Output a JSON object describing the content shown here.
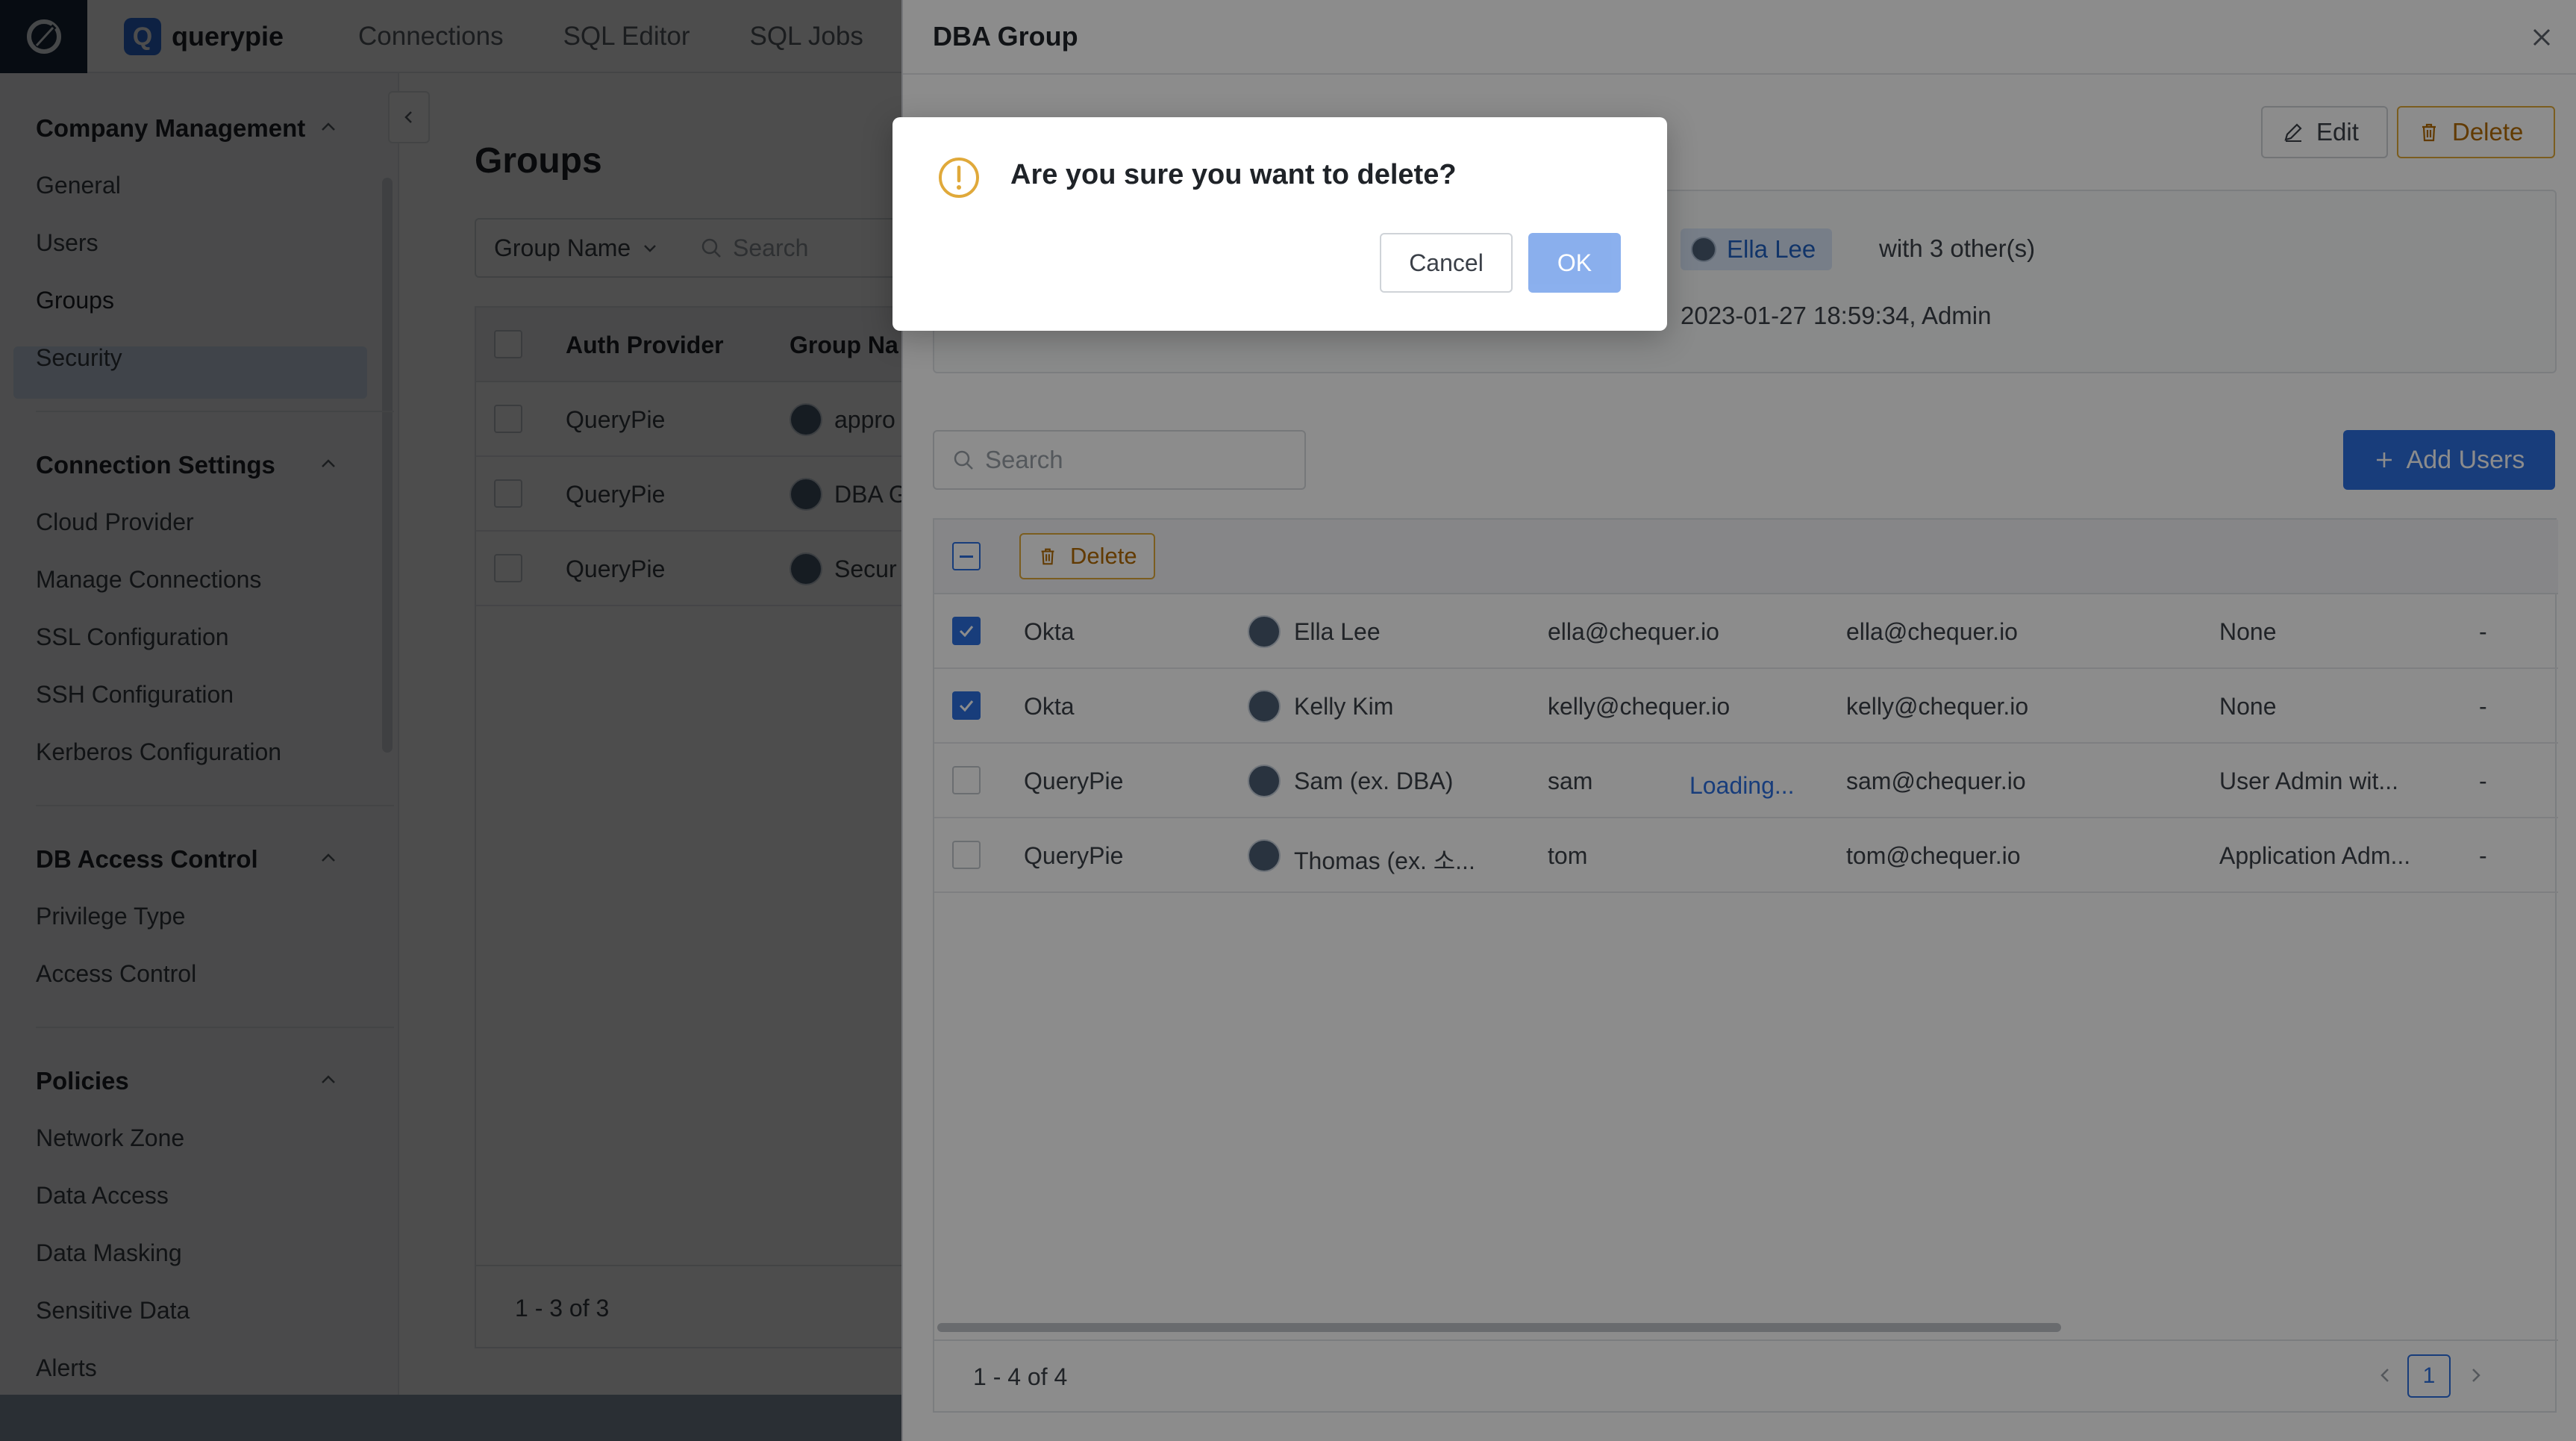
{
  "app": {
    "brand": "querypie",
    "brand_mark": "Q",
    "nav": [
      "Connections",
      "SQL Editor",
      "SQL Jobs"
    ]
  },
  "sidebar": {
    "sections": [
      {
        "title": "Company Management",
        "items": [
          "General",
          "Users",
          "Groups",
          "Security"
        ]
      },
      {
        "title": "Connection Settings",
        "items": [
          "Cloud Provider",
          "Manage Connections",
          "SSL Configuration",
          "SSH Configuration",
          "Kerberos Configuration"
        ]
      },
      {
        "title": "DB Access Control",
        "items": [
          "Privilege Type",
          "Access Control"
        ]
      },
      {
        "title": "Policies",
        "items": [
          "Network Zone",
          "Data Access",
          "Data Masking",
          "Sensitive Data",
          "Alerts"
        ]
      }
    ],
    "active_item": "Groups"
  },
  "groups_page": {
    "title": "Groups",
    "filter_field": "Group Name",
    "search_placeholder": "Search",
    "columns": [
      "Auth Provider",
      "Group Na"
    ],
    "rows": [
      {
        "provider": "QueryPie",
        "name": "appro"
      },
      {
        "provider": "QueryPie",
        "name": "DBA G"
      },
      {
        "provider": "QueryPie",
        "name": "Secur"
      }
    ],
    "footer": "1 - 3 of 3"
  },
  "drawer": {
    "title": "DBA Group",
    "edit_label": "Edit",
    "delete_label": "Delete",
    "owner_name": "Ella Lee",
    "owner_extra": "with 3 other(s)",
    "updated": "2023-01-27 18:59:34, Admin",
    "search_placeholder": "Search",
    "add_users_label": "Add Users",
    "bulk_delete_label": "Delete",
    "loading_text": "Loading...",
    "members": [
      {
        "checked": true,
        "provider": "Okta",
        "name": "Ella Lee",
        "login": "ella@chequer.io",
        "email": "ella@chequer.io",
        "role": "None",
        "extra": "-"
      },
      {
        "checked": true,
        "provider": "Okta",
        "name": "Kelly Kim",
        "login": "kelly@chequer.io",
        "email": "kelly@chequer.io",
        "role": "None",
        "extra": "-"
      },
      {
        "checked": false,
        "provider": "QueryPie",
        "name": "Sam (ex. DBA)",
        "login": "sam",
        "email": "sam@chequer.io",
        "role": "User Admin  wit...",
        "extra": "-"
      },
      {
        "checked": false,
        "provider": "QueryPie",
        "name": "Thomas (ex. 소...",
        "login": "tom",
        "email": "tom@chequer.io",
        "role": "Application Adm...",
        "extra": "-"
      }
    ],
    "footer": "1 - 4 of 4",
    "page": "1"
  },
  "dialog": {
    "message": "Are you sure you want to delete?",
    "cancel_label": "Cancel",
    "ok_label": "OK"
  },
  "colors": {
    "accent": "#2c6fe0",
    "warning": "#e0a93a",
    "danger_text": "#b26a00"
  }
}
